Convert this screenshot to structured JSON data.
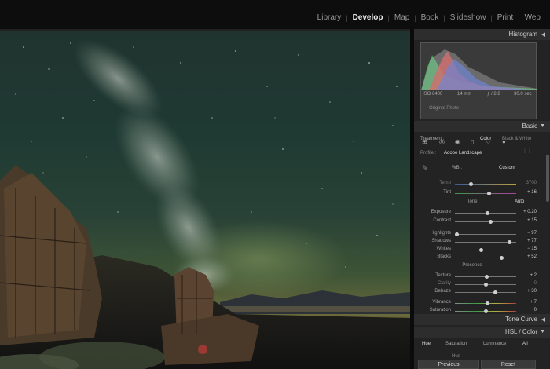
{
  "modules": [
    "Library",
    "Develop",
    "Map",
    "Book",
    "Slideshow",
    "Print",
    "Web"
  ],
  "active_module": "Develop",
  "histogram": {
    "title": "Histogram",
    "iso": "ISO 6400",
    "focal": "14 mm",
    "aperture": "ƒ / 2.8",
    "shutter": "30.0 sec",
    "original_photo": "Original Photo"
  },
  "basic": {
    "title": "Basic",
    "treatment_label": "Treatment :",
    "treatment_color": "Color",
    "treatment_bw": "Black & White",
    "profile_label": "Profile :",
    "profile_value": "Adobe Landscape",
    "wb_label": "WB :",
    "wb_value": "Custom",
    "tone_label": "Tone",
    "tone_auto": "Auto",
    "presence_label": "Presence"
  },
  "sliders": [
    {
      "label": "Temp",
      "value": "3700",
      "pos": 0.25,
      "dim": true
    },
    {
      "label": "Tint",
      "value": "+ 16",
      "pos": 0.55
    },
    {
      "label": "Exposure",
      "value": "+ 0.20",
      "pos": 0.52
    },
    {
      "label": "Contrast",
      "value": "+ 15",
      "pos": 0.58
    },
    {
      "label": "Highlights",
      "value": "− 97",
      "pos": 0.03
    },
    {
      "label": "Shadows",
      "value": "+ 77",
      "pos": 0.88
    },
    {
      "label": "Whites",
      "value": "− 15",
      "pos": 0.42
    },
    {
      "label": "Blacks",
      "value": "+ 52",
      "pos": 0.76
    },
    {
      "label": "Texture",
      "value": "+ 2",
      "pos": 0.51
    },
    {
      "label": "Clarity",
      "value": "0",
      "pos": 0.5,
      "dim": true
    },
    {
      "label": "Dehaze",
      "value": "+ 30",
      "pos": 0.65
    },
    {
      "label": "Vibrance",
      "value": "+ 7",
      "pos": 0.53
    },
    {
      "label": "Saturation",
      "value": "0",
      "pos": 0.5
    }
  ],
  "tone_curve": {
    "title": "Tone Curve"
  },
  "hsl": {
    "title": "HSL",
    "title2": "Color",
    "tabs": [
      "Hue",
      "Saturation",
      "Luminance",
      "All"
    ],
    "hue_label": "Hue"
  },
  "buttons": {
    "previous": "Previous",
    "reset": "Reset"
  },
  "colors": {
    "panel": "#232323",
    "header": "#2d2d2d",
    "accent_text": "#ececec"
  }
}
